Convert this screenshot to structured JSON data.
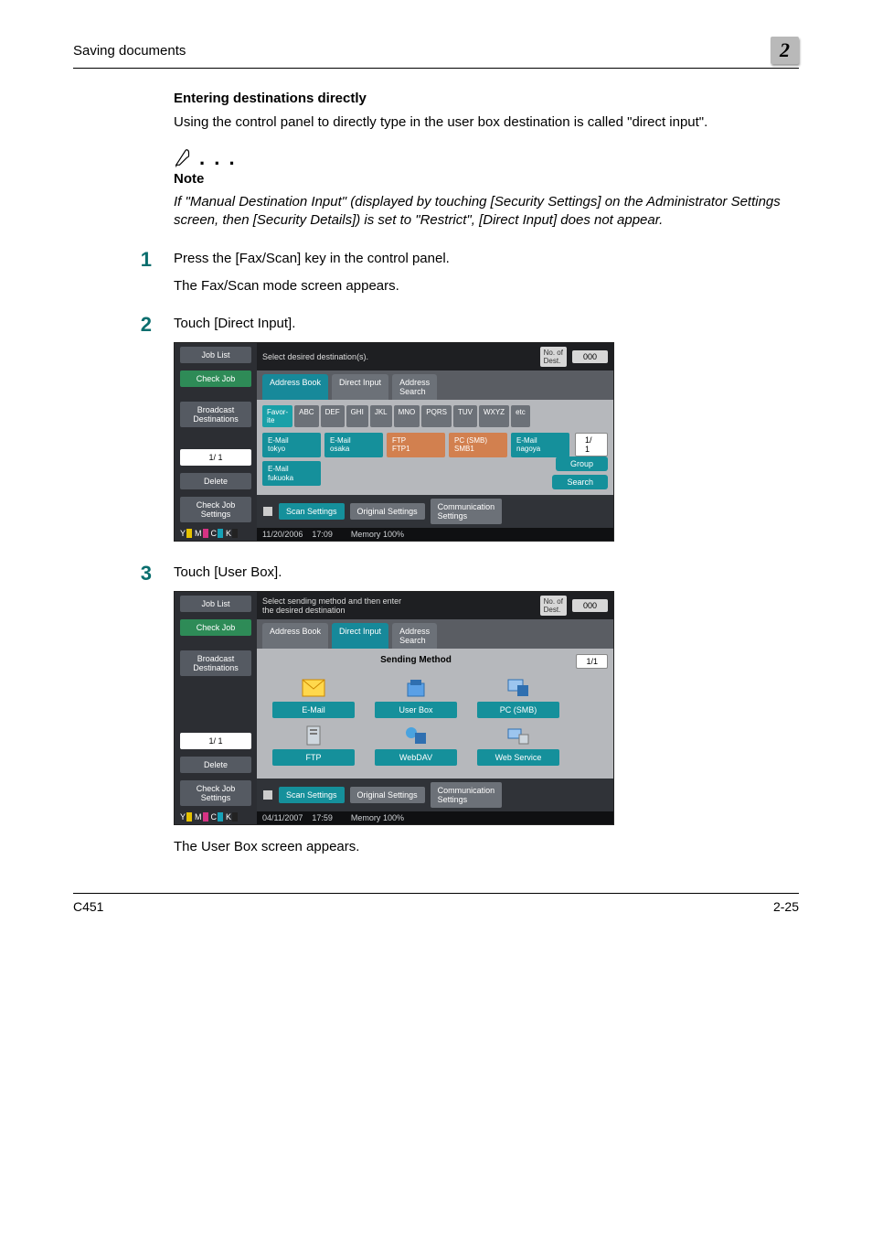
{
  "header": {
    "running_title": "Saving documents",
    "chapter_marker": "2"
  },
  "section_heading": "Entering destinations directly",
  "intro_paragraph": "Using the control panel to directly type in the user box destination is called \"direct input\".",
  "note": {
    "label": "Note",
    "body": "If \"Manual Destination Input\" (displayed by touching [Security Settings] on the Administrator Settings screen, then [Security Details]) is set to \"Restrict\", [Direct Input] does not appear."
  },
  "steps": {
    "s1": {
      "num": "1",
      "line1": "Press the [Fax/Scan] key in the control panel.",
      "line2": "The Fax/Scan mode screen appears."
    },
    "s2": {
      "num": "2",
      "line1": "Touch [Direct Input]."
    },
    "s3": {
      "num": "3",
      "line1": "Touch [User Box].",
      "after": "The User Box screen appears."
    }
  },
  "screen1": {
    "top_msg": "Select desired destination(s).",
    "counter": "000",
    "side": {
      "job_list": "Job List",
      "check_job": "Check Job",
      "broadcast": "Broadcast\nDestinations",
      "page": "1/  1",
      "delete": "Delete",
      "check_settings": "Check Job\nSettings"
    },
    "tabs": {
      "address_book": "Address Book",
      "direct_input": "Direct Input",
      "address_search": "Address\nSearch"
    },
    "alpha": [
      "Favor-\nite",
      "ABC",
      "DEF",
      "GHI",
      "JKL",
      "MNO",
      "PQRS",
      "TUV",
      "WXYZ",
      "etc"
    ],
    "dest": [
      {
        "l1": "E-Mail",
        "l2": "tokyo"
      },
      {
        "l1": "E-Mail",
        "l2": "osaka"
      },
      {
        "l1": "FTP",
        "l2": "FTP1"
      },
      {
        "l1": "PC (SMB)",
        "l2": "SMB1"
      },
      {
        "l1": "E-Mail",
        "l2": "nagoya"
      },
      {
        "l1": "E-Mail",
        "l2": "fukuoka"
      }
    ],
    "page_ind": "1/  1",
    "right": {
      "group": "Group",
      "search": "Search"
    },
    "bottom": {
      "scan": "Scan Settings",
      "original": "Original Settings",
      "comm": "Communication\nSettings"
    },
    "meta": {
      "date": "11/20/2006",
      "time": "17:09",
      "mem_label": "Memory",
      "mem_val": "100%"
    }
  },
  "screen2": {
    "top_msg": "Select sending method and then enter\nthe desired destination",
    "counter": "000",
    "side": {
      "job_list": "Job List",
      "check_job": "Check Job",
      "broadcast": "Broadcast\nDestinations",
      "page": "1/  1",
      "delete": "Delete",
      "check_settings": "Check Job\nSettings"
    },
    "tabs": {
      "address_book": "Address Book",
      "direct_input": "Direct Input",
      "address_search": "Address\nSearch"
    },
    "method_title": "Sending Method",
    "methods": {
      "email": "E-Mail",
      "userbox": "User Box",
      "pcsmb": "PC (SMB)",
      "ftp": "FTP",
      "webdav": "WebDAV",
      "webservice": "Web Service"
    },
    "page_ind": "1/1",
    "bottom": {
      "scan": "Scan Settings",
      "original": "Original Settings",
      "comm": "Communication\nSettings"
    },
    "meta": {
      "date": "04/11/2007",
      "time": "17:59",
      "mem_label": "Memory",
      "mem_val": "100%"
    }
  },
  "footer": {
    "model": "C451",
    "page": "2-25"
  }
}
